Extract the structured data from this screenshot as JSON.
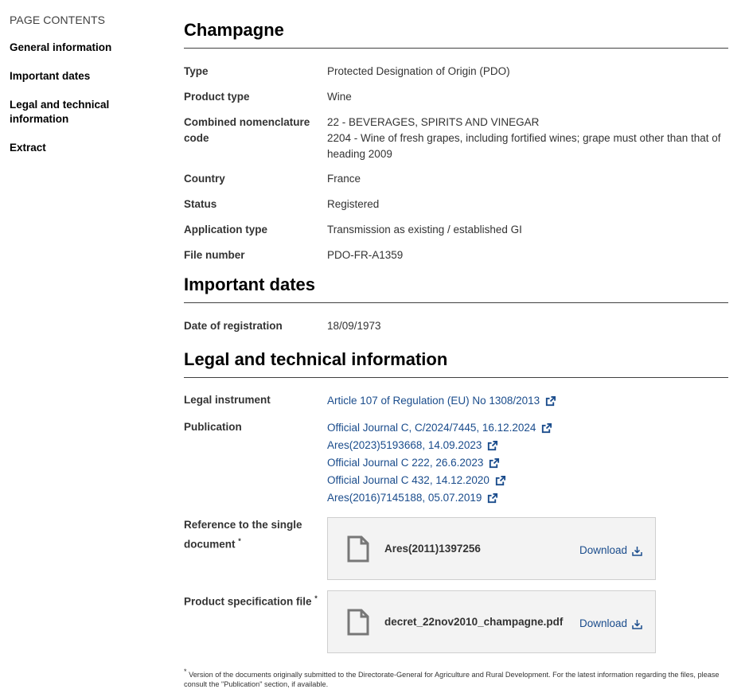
{
  "toc": {
    "title": "PAGE CONTENTS",
    "items": [
      "General information",
      "Important dates",
      "Legal and technical information",
      "Extract"
    ]
  },
  "general": {
    "heading": "Champagne",
    "rows": [
      {
        "label": "Type",
        "value": "Protected Designation of Origin (PDO)"
      },
      {
        "label": "Product type",
        "value": "Wine"
      },
      {
        "label": "Combined nomenclature code",
        "value": "22 - BEVERAGES, SPIRITS AND VINEGAR",
        "value2": "2204 - Wine of fresh grapes, including fortified wines; grape must other than that of heading 2009"
      },
      {
        "label": "Country",
        "value": "France"
      },
      {
        "label": "Status",
        "value": "Registered"
      },
      {
        "label": "Application type",
        "value": "Transmission as existing / established GI"
      },
      {
        "label": "File number",
        "value": "PDO-FR-A1359"
      }
    ]
  },
  "dates": {
    "heading": "Important dates",
    "rows": [
      {
        "label": "Date of registration",
        "value": "18/09/1973"
      }
    ]
  },
  "legal": {
    "heading": "Legal and technical information",
    "legal_instrument_label": "Legal instrument",
    "legal_instrument_link": "Article 107 of Regulation (EU) No 1308/2013",
    "publication_label": "Publication",
    "publications": [
      "Official Journal C, C/2024/7445, 16.12.2024",
      "Ares(2023)5193668, 14.09.2023",
      "Official Journal C 222, 26.6.2023",
      "Official Journal C 432, 14.12.2020",
      "Ares(2016)7145188, 05.07.2019"
    ],
    "single_doc_label": "Reference to the single document",
    "single_doc_file": "Ares(2011)1397256",
    "spec_label": "Product specification file",
    "spec_file": "decret_22nov2010_champagne.pdf",
    "download_label": "Download",
    "asterisk": "*"
  },
  "footnote": {
    "asterisk": "*",
    "text": "Version of the documents originally submitted to the Directorate-General for Agriculture and Rural Development. For the latest information regarding the files, please consult the \"Publication\" section, if available."
  },
  "colors": {
    "link": "#1a4c8c",
    "rule": "#404040",
    "box_bg": "#f3f3f3"
  },
  "icons": {
    "external": "external-link-icon",
    "download": "download-icon",
    "file": "file-icon"
  }
}
